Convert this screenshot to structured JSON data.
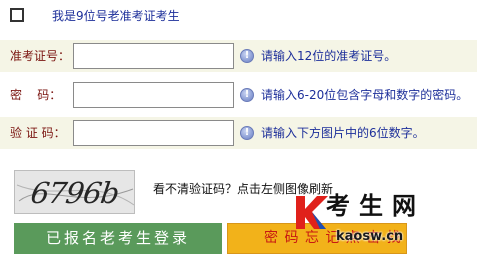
{
  "top": {
    "old_candidate_label": "我是9位号老准考证考生"
  },
  "form": {
    "rows": [
      {
        "label": "准考证号：",
        "value": "",
        "hint": "请输入12位的准考证号。"
      },
      {
        "label": "密    码：",
        "value": "",
        "hint": "请输入6-20位包含字母和数字的密码。"
      },
      {
        "label": "验 证 码：",
        "value": "",
        "hint": "请输入下方图片中的6位数字。"
      }
    ]
  },
  "captcha": {
    "code": "6796b",
    "help": "看不清验证码？点击左侧图像刷新"
  },
  "buttons": {
    "login_label": "已报名老考生登录",
    "forgot_label": "密 码 忘 记 点 击 找 回"
  },
  "watermark": {
    "brand": "考生网",
    "url": "kaosw.cn"
  },
  "colors": {
    "label_red": "#7a1410",
    "hint_blue": "#1d2f9a",
    "login_green": "#5a9a5b",
    "forgot_yellow": "#f2b21a",
    "watermark_red": "#e0211b"
  }
}
